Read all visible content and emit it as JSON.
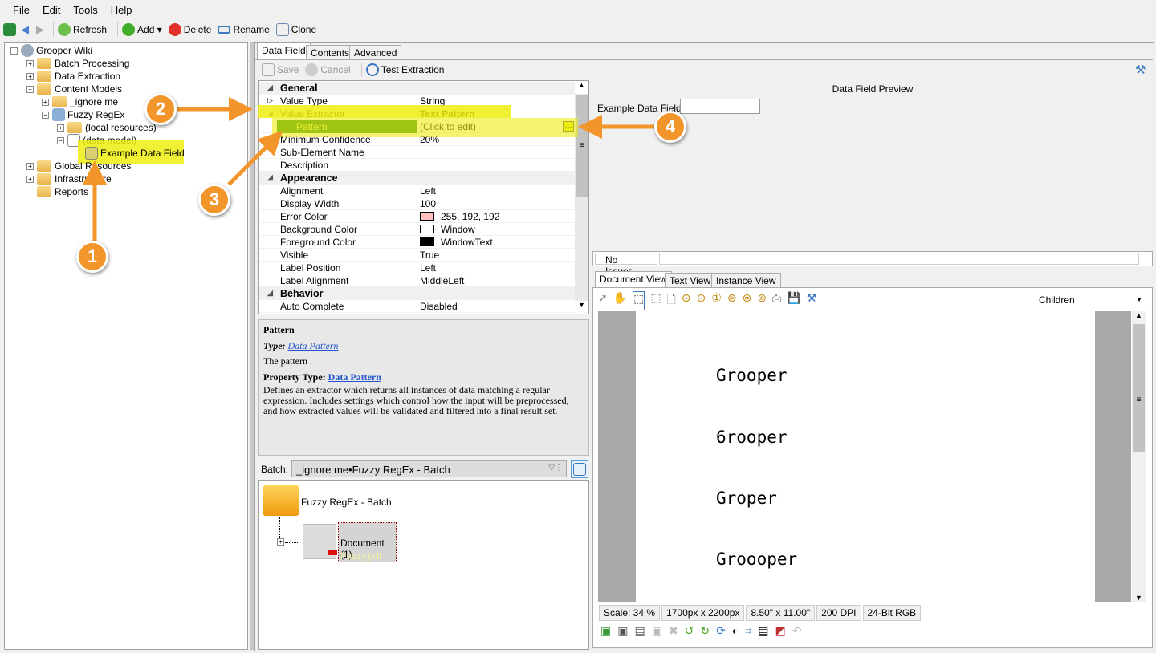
{
  "menu": [
    "File",
    "Edit",
    "Tools",
    "Help"
  ],
  "toolbar": {
    "refresh": "Refresh",
    "add": "Add",
    "delete": "Delete",
    "rename": "Rename",
    "clone": "Clone"
  },
  "tree": {
    "root": "Grooper Wiki",
    "items": [
      "Batch Processing",
      "Data Extraction",
      "Content Models",
      "_ignore me",
      "Fuzzy RegEx",
      "(local resources)",
      "(data model)",
      "Example Data Field",
      "Global Resources",
      "Infrastructure",
      "Reports"
    ]
  },
  "editor": {
    "tabs": [
      "Data Field",
      "Contents",
      "Advanced"
    ],
    "save": "Save",
    "cancel": "Cancel",
    "test_extraction": "Test Extraction"
  },
  "properties": [
    {
      "cat": "General"
    },
    {
      "name": "Value Type",
      "value": "String"
    },
    {
      "name": "Value Extractor",
      "value": "Text Pattern"
    },
    {
      "name": "Pattern",
      "value": "(Click to edit)"
    },
    {
      "name": "Minimum Confidence",
      "value": "20%"
    },
    {
      "name": "Sub-Element Name",
      "value": ""
    },
    {
      "name": "Description",
      "value": ""
    },
    {
      "cat": "Appearance"
    },
    {
      "name": "Alignment",
      "value": "Left"
    },
    {
      "name": "Display Width",
      "value": "100"
    },
    {
      "name": "Error Color",
      "value": "255, 192, 192",
      "swatch": "#ffc0c0"
    },
    {
      "name": "Background Color",
      "value": "Window",
      "swatch": "#ffffff"
    },
    {
      "name": "Foreground Color",
      "value": "WindowText",
      "swatch": "#000000"
    },
    {
      "name": "Visible",
      "value": "True"
    },
    {
      "name": "Label Position",
      "value": "Left"
    },
    {
      "name": "Label Alignment",
      "value": "MiddleLeft"
    },
    {
      "cat": "Behavior"
    },
    {
      "name": "Auto Complete",
      "value": "Disabled"
    }
  ],
  "help": {
    "title": "Pattern",
    "type_label": "Type:",
    "type_link": "Data Pattern",
    "desc": "The pattern .",
    "ptype_label": "Property Type:",
    "ptype_link": "Data Pattern",
    "ptype_desc": "Defines an extractor which returns all instances of data matching a regular expression. Includes settings which control how the input will be preprocessed, and how extracted values will be validated and filtered into a final result set."
  },
  "batch": {
    "label": "Batch:",
    "value": "_ignore me•Fuzzy RegEx - Batch",
    "folder": "Fuzzy RegEx - Batch",
    "document": "Document (1)",
    "file": "Fuzzy.pdf"
  },
  "preview": {
    "title": "Data Field Preview",
    "field_label": "Example Data Field",
    "field_value": "",
    "issues": "No Issues"
  },
  "docview": {
    "tabs": [
      "Document View",
      "Text View",
      "Instance View"
    ],
    "scope": "Children",
    "lines": [
      "Grooper",
      "6rooper",
      "Groper",
      "Groooper"
    ],
    "status": [
      "Scale: 34 %",
      "1700px x 2200px",
      "8.50\" x 11.00\"",
      "200 DPI",
      "24-Bit RGB"
    ]
  },
  "annotations": [
    "1",
    "2",
    "3",
    "4"
  ],
  "colors": {
    "highlight": "#eded12",
    "annotation": "#f2962c",
    "selected_row": "#2e8b1a"
  }
}
